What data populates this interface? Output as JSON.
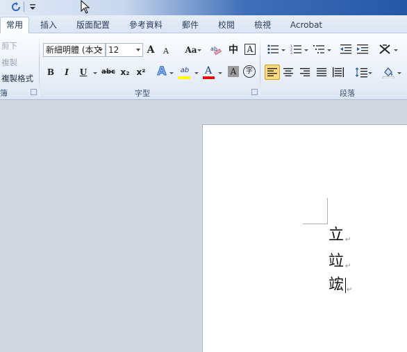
{
  "quick_access": {
    "icons": [
      "redo-icon",
      "customize-qat-icon"
    ]
  },
  "tabs": [
    "常用",
    "插入",
    "版面配置",
    "參考資料",
    "郵件",
    "校閱",
    "檢視",
    "Acrobat"
  ],
  "ribbon": {
    "clipboard": {
      "cut_label": "剪下",
      "copy_label": "複製",
      "format_painter_label": "複製格式",
      "group_label_fragment": "簿"
    },
    "font": {
      "font_name": "新細明體 (本文",
      "font_size": "12",
      "grow_label": "A",
      "shrink_label": "A",
      "case_label": "Aa",
      "phonetic_label": "中",
      "char_border_label": "A",
      "bold_label": "B",
      "italic_label": "I",
      "underline_label": "U",
      "strike_label": "abc",
      "subscript_label": "x₂",
      "superscript_label": "x²",
      "text_effect_label": "A",
      "highlight_label": "ab",
      "font_color_label": "A",
      "char_shading_label": "A",
      "enclose_label": "字",
      "group_label": "字型"
    },
    "paragraph": {
      "group_label": "段落"
    }
  },
  "document": {
    "lines": [
      "立",
      "竝",
      "竤"
    ],
    "paragraph_mark": "↵"
  },
  "colors": {
    "highlight": "#ffff00",
    "font_color": "#e01010",
    "active_align": "#ffd97a"
  }
}
